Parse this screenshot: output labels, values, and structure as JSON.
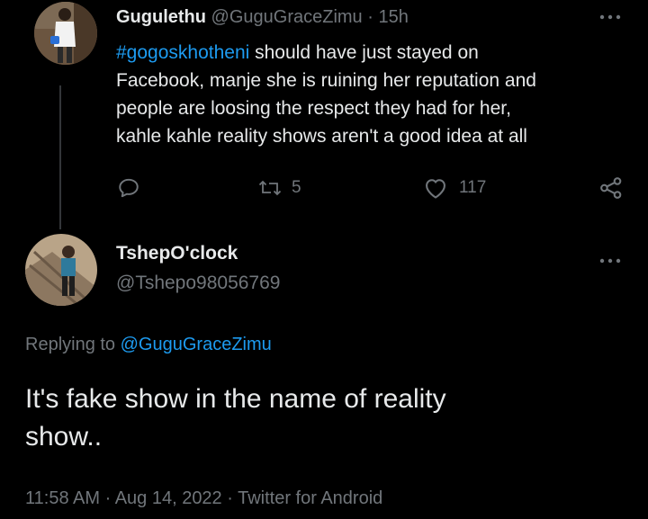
{
  "parent_tweet": {
    "display_name": "Gugulethu",
    "handle": "@GuguGraceZimu",
    "separator": "·",
    "time_ago": "15h",
    "hashtag": "#gogoskhotheni",
    "text_lines": [
      " should have just stayed on",
      "Facebook, manje she is ruining her reputation and",
      "people are loosing the respect they had for her,",
      "kahle kahle reality shows aren't a good idea at all"
    ],
    "retweet_count": "5",
    "like_count": "117",
    "more_icon": "more-dots-icon"
  },
  "reply_tweet": {
    "display_name": "TshepO'clock",
    "handle": "@Tshepo98056769",
    "replying_prefix": "Replying to ",
    "replying_to": "@GuguGraceZimu",
    "text_lines": [
      "It's fake show in the name of reality",
      "show.."
    ],
    "meta": "11:58 AM · Aug 14, 2022 · Twitter for Android"
  },
  "colors": {
    "background": "#000000",
    "text": "#e7e9ea",
    "muted": "#71767b",
    "link": "#1d9bf0"
  }
}
